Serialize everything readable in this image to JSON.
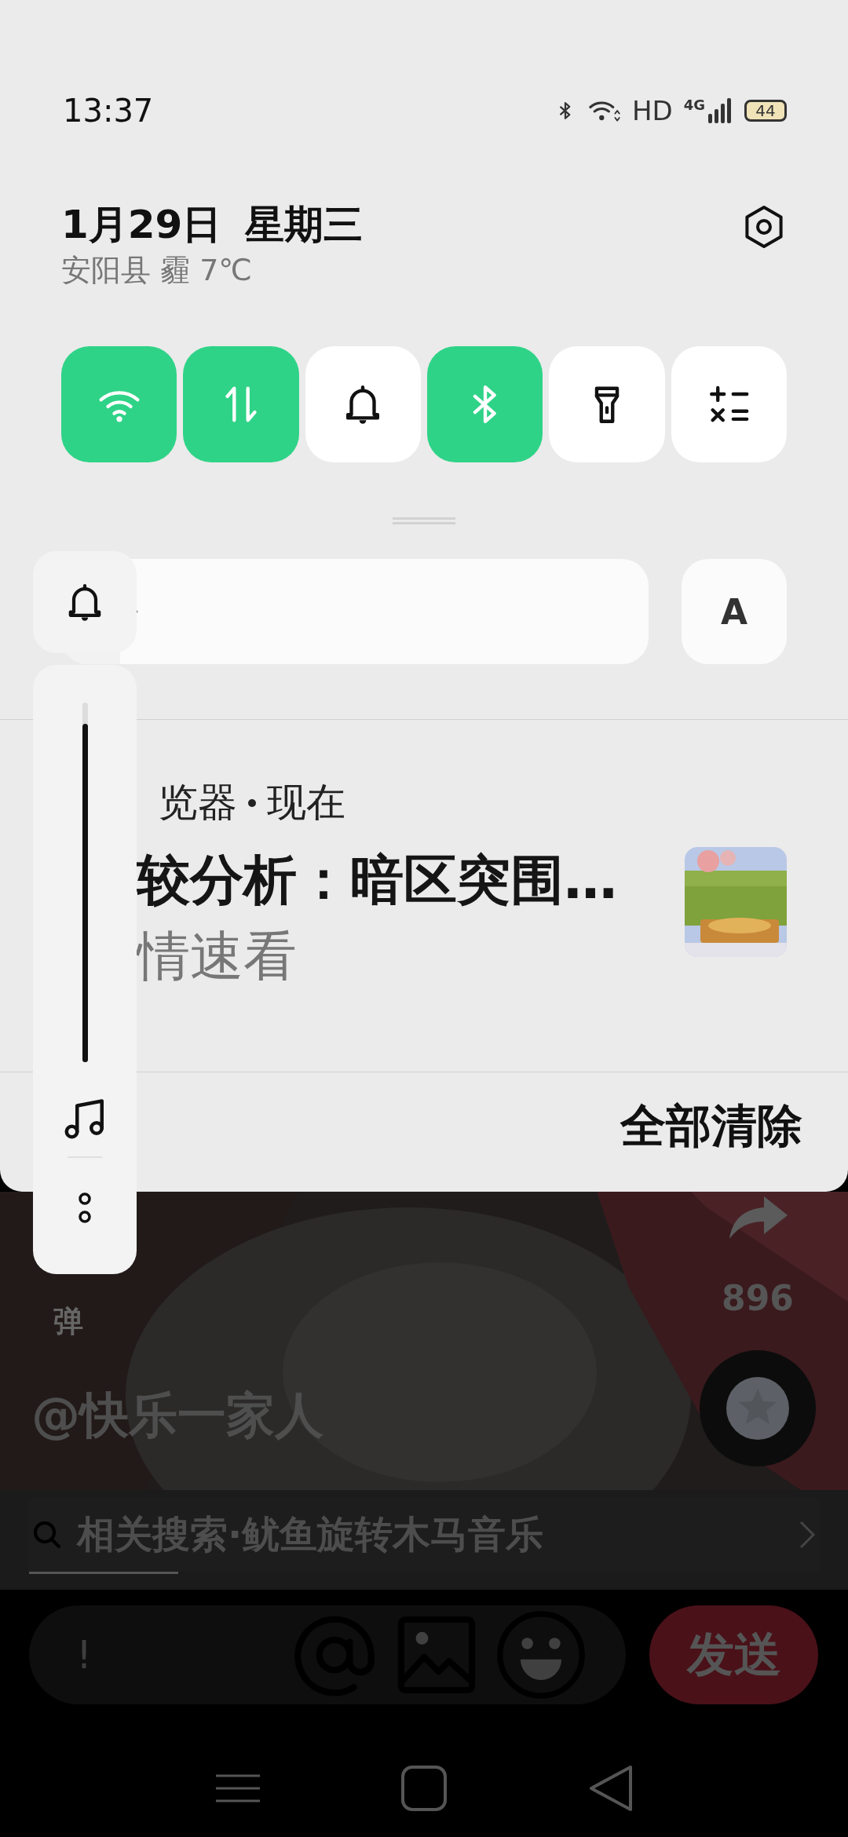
{
  "status_bar": {
    "time": "13:37",
    "network_label": "HD",
    "cellular_label": "4G",
    "battery": "44"
  },
  "header": {
    "date": "1月29日",
    "weekday": "星期三",
    "weather": "安阳县 霾 7℃"
  },
  "quick_tiles": [
    {
      "kind": "wifi",
      "on": true
    },
    {
      "kind": "mobile-data",
      "on": true
    },
    {
      "kind": "ringer",
      "on": false
    },
    {
      "kind": "bluetooth",
      "on": true
    },
    {
      "kind": "flashlight",
      "on": false
    },
    {
      "kind": "calculator",
      "on": false
    }
  ],
  "brightness": {
    "level": 0.1,
    "auto_label": "A"
  },
  "notification": {
    "app": "览器",
    "time": "现在",
    "title": "较分析：暗区突围…",
    "body": "情速看"
  },
  "clear_all": "全部清除",
  "volume": {
    "level": 0.94
  },
  "background_app": {
    "share_count": "896",
    "danmaku": "弹",
    "author": "@快乐一家人",
    "related_search": "相关搜索·鱿鱼旋转木马音乐",
    "comment_value": "!",
    "send": "发送"
  }
}
